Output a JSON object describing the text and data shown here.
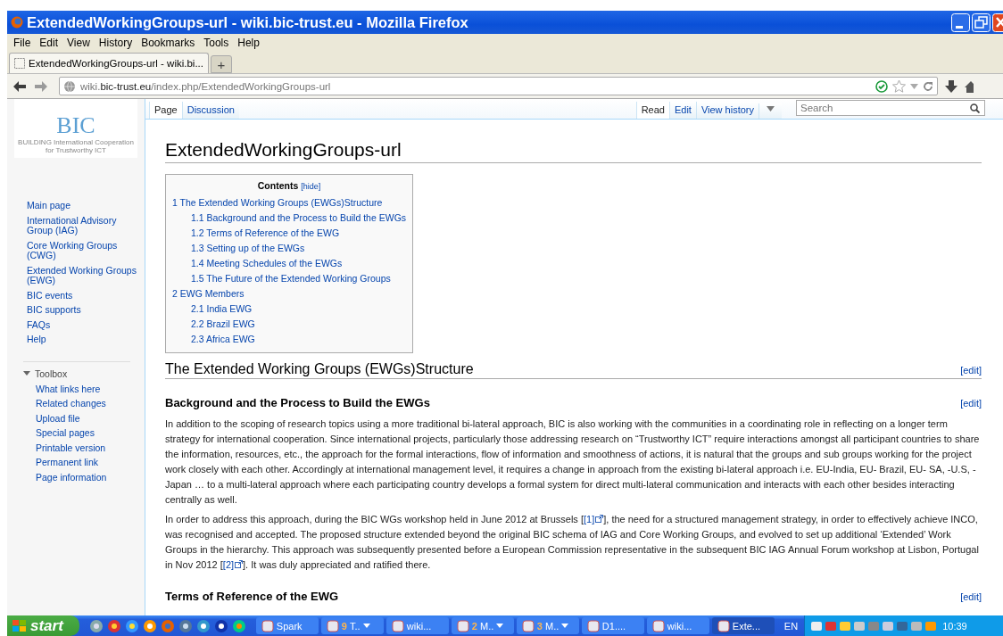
{
  "window": {
    "title": "ExtendedWorkingGroups-url - wiki.bic-trust.eu - Mozilla Firefox"
  },
  "menu": [
    "File",
    "Edit",
    "View",
    "History",
    "Bookmarks",
    "Tools",
    "Help"
  ],
  "tabs": [
    {
      "label": "ExtendedWorkingGroups-url - wiki.bi...",
      "selected": true
    }
  ],
  "new_tab": "+",
  "address": {
    "prefix": "wiki.",
    "domain": "bic-trust.eu",
    "path": "/index.php/ExtendedWorkingGroups-url"
  },
  "sidebar": {
    "logo": {
      "name": "BIC",
      "tagline": "BUILDING International Cooperation for Trustworthy ICT"
    },
    "items": [
      "Main page",
      "International Advisory Group (IAG)",
      "Core Working Groups (CWG)",
      "Extended Working Groups (EWG)",
      "BIC events",
      "BIC supports",
      "FAQs",
      "Help"
    ],
    "toolbox": {
      "title": "Toolbox",
      "expanded": true,
      "items": [
        "What links here",
        "Related changes",
        "Upload file",
        "Special pages",
        "Printable version",
        "Permanent link",
        "Page information"
      ]
    }
  },
  "page_tabs": [
    {
      "label": "Page",
      "selected": true
    },
    {
      "label": "Discussion",
      "selected": false
    }
  ],
  "view_tabs": [
    {
      "label": "Read",
      "selected": true
    },
    {
      "label": "Edit",
      "selected": false
    },
    {
      "label": "View history",
      "selected": false
    }
  ],
  "search": {
    "placeholder": "Search"
  },
  "article": {
    "title": "ExtendedWorkingGroups-url",
    "toc": {
      "title": "Contents",
      "toggle": "[hide]",
      "items": [
        {
          "label": "1 The Extended Working Groups (EWGs)Structure",
          "children": [
            {
              "label": "1.1 Background and the Process to Build the EWGs"
            },
            {
              "label": "1.2 Terms of Reference of the EWG"
            },
            {
              "label": "1.3 Setting up of the EWGs"
            },
            {
              "label": "1.4 Meeting Schedules of the EWGs"
            },
            {
              "label": "1.5 The Future of the Extended Working Groups"
            }
          ]
        },
        {
          "label": "2 EWG Members",
          "children": [
            {
              "label": "2.1 India EWG"
            },
            {
              "label": "2.2 Brazil EWG"
            },
            {
              "label": "2.3 Africa EWG"
            }
          ]
        }
      ]
    },
    "blocks": [
      {
        "kind": "h2",
        "text": "The Extended Working Groups (EWGs)Structure",
        "edit": "[edit]"
      },
      {
        "kind": "h3",
        "text": "Background and the Process to Build the EWGs",
        "edit": "[edit]"
      },
      {
        "kind": "p",
        "parts": [
          {
            "kind": "text",
            "text": "In addition to the scoping of research topics using a more traditional bi-lateral approach, BIC is also working with the communities in a coordinating role in reflecting on a longer term strategy for international cooperation. Since international projects, particularly those addressing research on “Trustworthy ICT” require interactions amongst all participant countries to share the information, resources, etc., the approach for the formal interactions, flow of information and smoothness of actions, it is natural that the groups and sub groups working for the project work closely with each other. Accordingly at international management level, it requires a change in approach from the existing bi-lateral approach i.e. EU-India, EU- Brazil, EU- SA, -U.S, -Japan … to a multi-lateral approach where each participating country develops a formal system for direct multi-lateral communication and interacts with each other besides interacting centrally as well."
          }
        ]
      },
      {
        "kind": "p",
        "parts": [
          {
            "kind": "text",
            "text": "In order to address this approach, during the BIC WGs workshop held in June 2012 at Brussels ["
          },
          {
            "kind": "link",
            "text": "[1]"
          },
          {
            "kind": "text",
            "text": "], the need for a structured management strategy, in order to effectively achieve INCO, was recognised and accepted. The proposed structure extended beyond the original BIC schema of IAG and Core Working Groups, and evolved to set up additional ‘Extended’ Work Groups in the hierarchy. This approach was subsequently presented before a European Commission representative in the subsequent BIC IAG Annual Forum workshop at Lisbon, Portugal in Nov 2012 ["
          },
          {
            "kind": "link",
            "text": "[2]"
          },
          {
            "kind": "text",
            "text": "]. It was duly appreciated and ratified there."
          }
        ]
      },
      {
        "kind": "h3",
        "text": "Terms of Reference of the EWG",
        "edit": "[edit]"
      }
    ]
  },
  "taskbar": {
    "start": "start",
    "tasks": [
      {
        "label": "Spark",
        "active": false,
        "menu": false
      },
      {
        "label": "T..",
        "count": "9",
        "active": false,
        "menu": true
      },
      {
        "label": "wiki...",
        "active": false,
        "menu": false
      },
      {
        "label": "M..",
        "count": "2",
        "active": false,
        "menu": true
      },
      {
        "label": "M..",
        "count": "3",
        "active": false,
        "menu": true
      },
      {
        "label": "D1....",
        "active": false,
        "menu": false
      },
      {
        "label": "wiki...",
        "active": false,
        "menu": false
      },
      {
        "label": "Exte...",
        "active": true,
        "menu": false
      }
    ],
    "language": "EN",
    "clock": "10:39"
  }
}
